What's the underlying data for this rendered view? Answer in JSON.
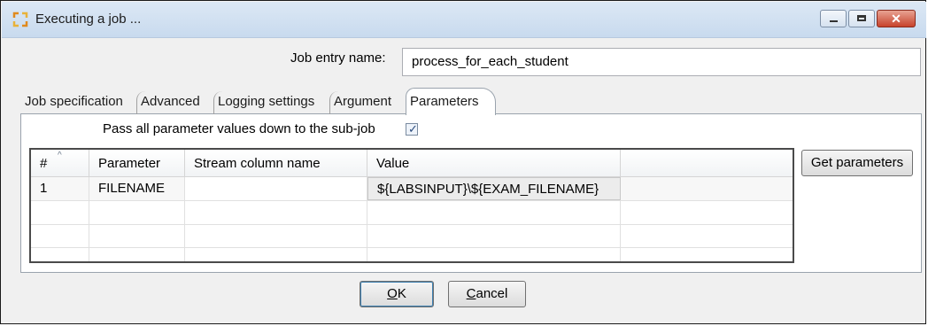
{
  "window": {
    "title": "Executing a job ...",
    "icon": "kettle-job-icon"
  },
  "job_entry": {
    "label": "Job entry name:",
    "value": "process_for_each_student"
  },
  "tabs": [
    {
      "label": "Job specification"
    },
    {
      "label": "Advanced"
    },
    {
      "label": "Logging settings"
    },
    {
      "label": "Argument"
    },
    {
      "label": "Parameters",
      "active": true
    }
  ],
  "pass_all": {
    "label": "Pass all parameter values down to the sub-job",
    "checked": true
  },
  "grid": {
    "columns": [
      "#",
      "Parameter",
      "Stream column name",
      "Value",
      ""
    ],
    "rows": [
      {
        "num": "1",
        "parameter": "FILENAME",
        "stream": "",
        "value": "${LABSINPUT}\\${EXAM_FILENAME}"
      }
    ]
  },
  "buttons": {
    "get_parameters": "Get parameters",
    "ok_u": "O",
    "ok_rest": "K",
    "cancel_u": "C",
    "cancel_rest": "ancel"
  }
}
